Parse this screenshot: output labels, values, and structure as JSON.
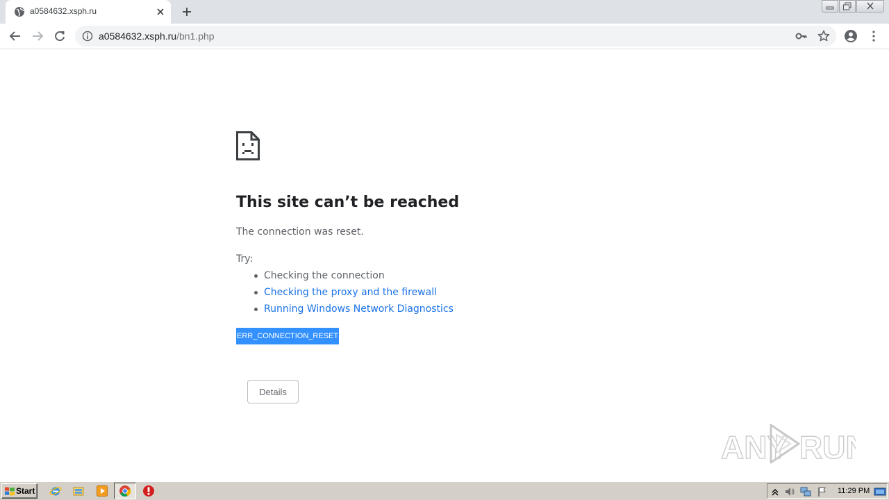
{
  "browser": {
    "tab": {
      "title": "a0584632.xsph.ru",
      "favicon": "globe-icon"
    },
    "omnibox": {
      "host": "a0584632.xsph.ru",
      "path": "/bn1.php"
    }
  },
  "error_page": {
    "icon": "sad-document-icon",
    "title": "This site can’t be reached",
    "message": "The connection was reset.",
    "try_label": "Try:",
    "suggestions": [
      {
        "label": "Checking the connection",
        "is_link": false
      },
      {
        "label": "Checking the proxy and the firewall",
        "is_link": true
      },
      {
        "label": "Running Windows Network Diagnostics",
        "is_link": true
      }
    ],
    "error_code": "ERR_CONNECTION_RESET",
    "details_button": "Details"
  },
  "watermark": {
    "text_left": "ANY",
    "text_right": "RUN"
  },
  "taskbar": {
    "start_label": "Start",
    "apps": [
      "internet-explorer-icon",
      "folder-icon",
      "media-player-icon",
      "chrome-icon",
      "antivirus-icon"
    ],
    "clock": "11:29 PM"
  },
  "colors": {
    "link": "#1a73e8",
    "selection": "#3390ff",
    "tabstrip": "#dee1e6"
  }
}
